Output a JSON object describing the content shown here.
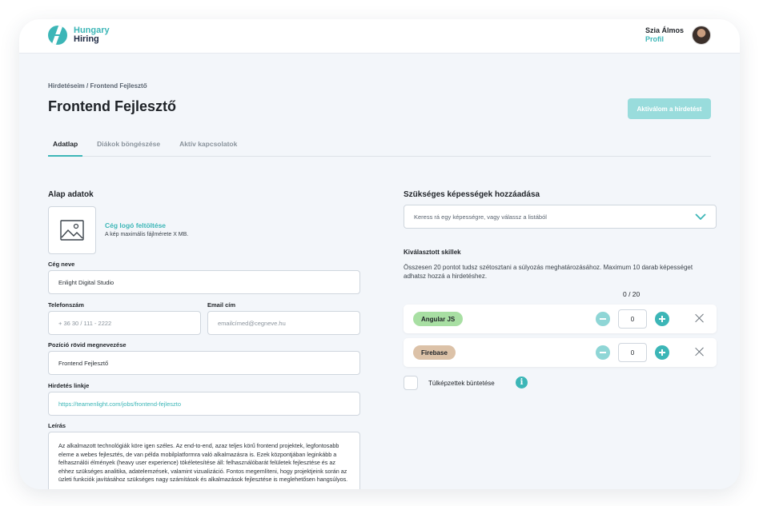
{
  "header": {
    "logo_line1": "Hungary",
    "logo_line2": "Hiring",
    "user_greeting": "Szia Álmos",
    "user_profile_link": "Profil"
  },
  "breadcrumb": "Hirdetéseim / Frontend Fejlesztő",
  "page_title": "Frontend Fejlesztő",
  "activate_button": "Aktiválom a hirdetést",
  "tabs": [
    {
      "label": "Adatlap",
      "active": true
    },
    {
      "label": "Diákok böngészése",
      "active": false
    },
    {
      "label": "Aktív kapcsolatok",
      "active": false
    }
  ],
  "basic": {
    "section_title": "Alap adatok",
    "upload_link": "Cég logó feltöltése",
    "upload_hint": "A kép maximális fájlmérete X MB.",
    "company_label": "Cég neve",
    "company_value": "Enlight Digital Studio",
    "phone_label": "Telefonszám",
    "phone_placeholder": "+ 36 30 / 111 - 2222",
    "email_label": "Email cím",
    "email_placeholder": "emailcímed@cegneve.hu",
    "position_label": "Pozíció rövid megnevezése",
    "position_value": "Frontend Fejlesztő",
    "link_label": "Hirdetés linkje",
    "link_value": "https://teamenlight.com/jobs/frontend-fejleszto",
    "description_label": "Leírás",
    "description_value": "Az alkalmazott technológiák köre igen széles. Az end-to-end, azaz teljes körű frontend projektek, legfontosabb eleme a webes fejlesztés, de van példa mobilplatformra való alkalmazásra is. Ezek központjában leginkább a felhasználói élmények (heavy user experience) tökéletesítése áll: felhasználóbarát felületek fejlesztése és az ehhez szükséges analitika, adatelemzések, valamint vizualizáció. Fontos megemlíteni, hogy projektjeink során az üzleti funkciók javításához szükséges nagy számítások és alkalmazások fejlesztése is meglehetősen hangsúlyos."
  },
  "skills": {
    "section_title": "Szükséges képességek hozzáadása",
    "select_placeholder": "Keress rá egy képességre, vagy válassz a listából",
    "selected_title": "Kiválasztott skillek",
    "description": "Összesen 20 pontot tudsz szétosztani a súlyozás meghatározásához. Maximum 10 darab képességet adhatsz hozzá a hirdetéshez.",
    "points": "0 / 20",
    "items": [
      {
        "name": "Angular JS",
        "value": "0",
        "color": "#a8dfa3"
      },
      {
        "name": "Firebase",
        "value": "0",
        "color": "#dcc2a8"
      }
    ],
    "overqualified_label": "Túlképzettek büntetése"
  },
  "colors": {
    "accent": "#3cb6b7",
    "accent_light": "#99dcdc"
  }
}
